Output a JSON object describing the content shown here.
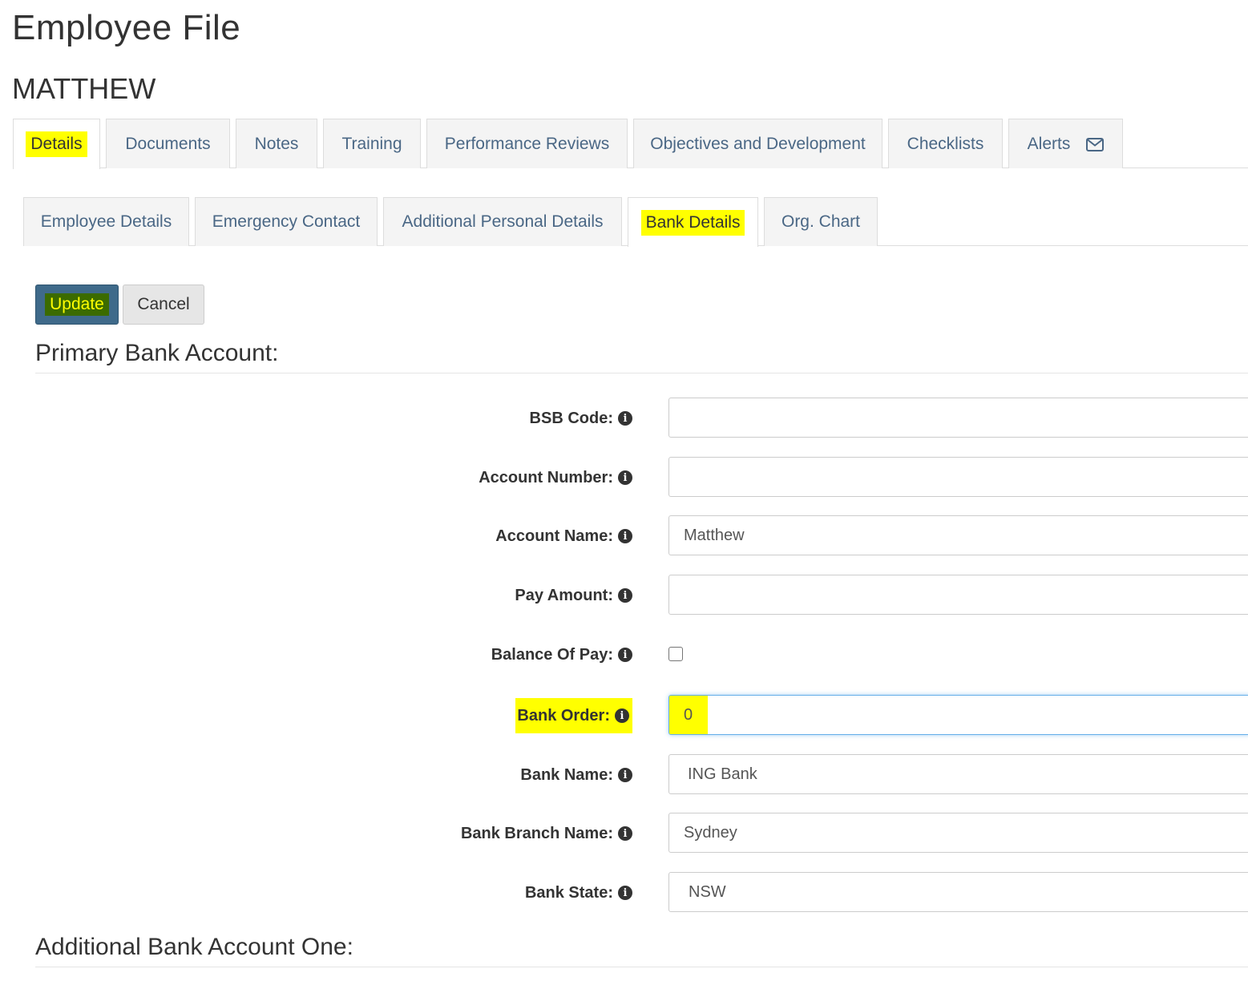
{
  "header": {
    "title": "Employee File",
    "employee_name": "MATTHEW"
  },
  "main_tabs": [
    {
      "label": "Details",
      "active": true,
      "highlighted": true
    },
    {
      "label": "Documents"
    },
    {
      "label": "Notes"
    },
    {
      "label": "Training"
    },
    {
      "label": "Performance Reviews"
    },
    {
      "label": "Objectives and Development"
    },
    {
      "label": "Checklists"
    },
    {
      "label": "Alerts",
      "icon": "envelope-icon"
    }
  ],
  "sub_tabs": [
    {
      "label": "Employee Details"
    },
    {
      "label": "Emergency Contact"
    },
    {
      "label": "Additional Personal Details"
    },
    {
      "label": "Bank Details",
      "active": true,
      "highlighted": true
    },
    {
      "label": "Org. Chart"
    }
  ],
  "actions": {
    "update_label": "Update",
    "cancel_label": "Cancel"
  },
  "primary_section": {
    "title": "Primary Bank Account:",
    "fields": {
      "bsb_code": {
        "label": "BSB Code:",
        "value": ""
      },
      "account_number": {
        "label": "Account Number:",
        "value": ""
      },
      "account_name": {
        "label": "Account Name:",
        "value": "Matthew"
      },
      "pay_amount": {
        "label": "Pay Amount:",
        "value": ""
      },
      "balance_of_pay": {
        "label": "Balance Of Pay:",
        "checked": false
      },
      "bank_order": {
        "label": "Bank Order:",
        "value": "0"
      },
      "bank_name": {
        "label": "Bank Name:",
        "value": "ING Bank"
      },
      "bank_branch_name": {
        "label": "Bank Branch Name:",
        "value": "Sydney"
      },
      "bank_state": {
        "label": "Bank State:",
        "value": "NSW"
      }
    }
  },
  "additional_section": {
    "title": "Additional Bank Account One:"
  },
  "colors": {
    "tab_text": "#4a6785",
    "primary_button": "#3f6a8a",
    "highlight": "#ffff00",
    "focus_border": "#66afe9"
  }
}
